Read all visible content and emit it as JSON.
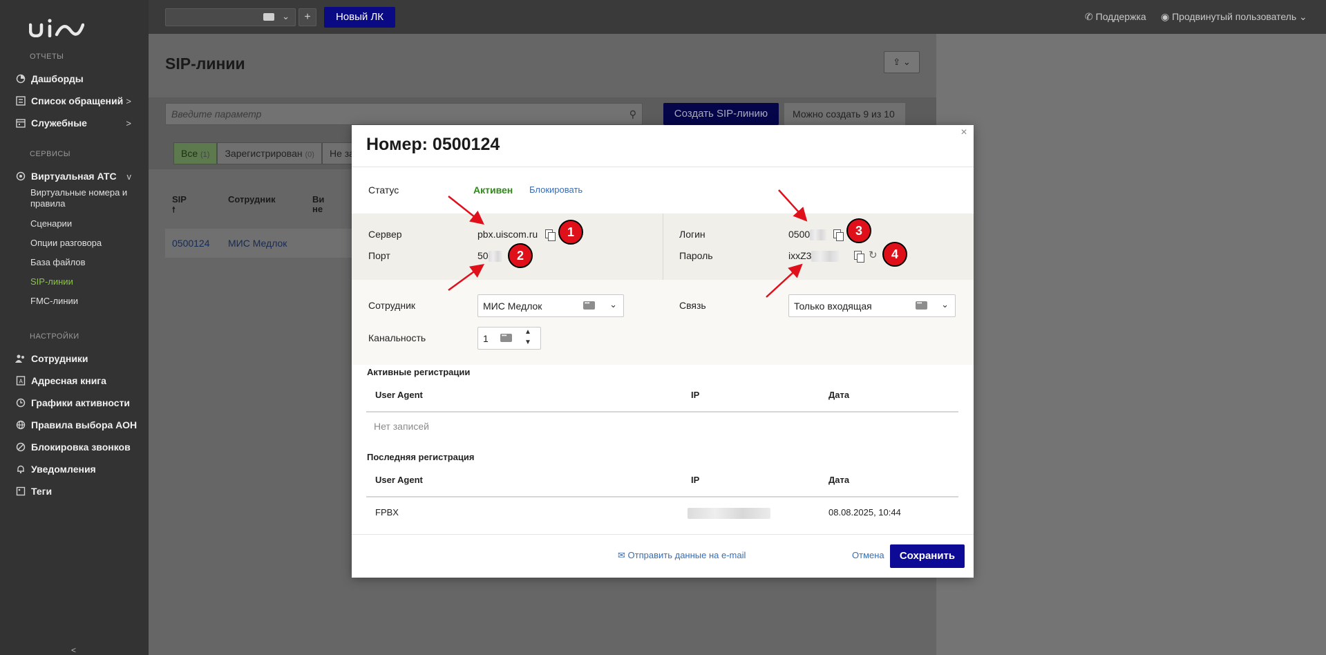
{
  "app": {
    "logo_text": "uis"
  },
  "sidebar": {
    "reports_header": "ОТЧЕТЫ",
    "services_header": "СЕРВИСЫ",
    "settings_header": "НАСТРОЙКИ",
    "reports": [
      {
        "label": "Дашборды",
        "icon": "pie-chart-icon",
        "chevron": ""
      },
      {
        "label": "Список обращений",
        "icon": "list-icon",
        "chevron": ">"
      },
      {
        "label": "Служебные",
        "icon": "calendar-icon",
        "chevron": ">"
      }
    ],
    "vats": {
      "label": "Виртуальная АТС",
      "icon": "vats-icon",
      "chevron": "v"
    },
    "vats_sub": [
      "Виртуальные номера и правила",
      "Сценарии",
      "Опции разговора",
      "База файлов",
      "SIP-линии",
      "FMC-линии"
    ],
    "settings": [
      {
        "label": "Сотрудники",
        "icon": "users-icon"
      },
      {
        "label": "Адресная книга",
        "icon": "address-book-icon"
      },
      {
        "label": "Графики активности",
        "icon": "clock-icon"
      },
      {
        "label": "Правила выбора АОН",
        "icon": "globe-icon"
      },
      {
        "label": "Блокировка звонков",
        "icon": "block-icon"
      },
      {
        "label": "Уведомления",
        "icon": "bell-icon"
      },
      {
        "label": "Теги",
        "icon": "tag-icon"
      }
    ],
    "collapse_glyph": "<"
  },
  "topbar": {
    "new_lk": "Новый ЛК",
    "plus": "+",
    "support": "Поддержка",
    "user": "Продвинутый пользователь"
  },
  "page": {
    "title": "SIP-линии",
    "search_placeholder": "Введите параметр",
    "create_button": "Создать SIP-линию",
    "limit_note": "Можно создать 9 из 10",
    "tabs": [
      {
        "label": "Все",
        "count": "(1)"
      },
      {
        "label": "Зарегистрирован",
        "count": "(0)"
      },
      {
        "label": "Не зар",
        "count": ""
      }
    ],
    "columns": [
      "SIP",
      "Сотрудник",
      "Ви",
      "не"
    ],
    "sort_arrow": "🠕",
    "row": {
      "sip": "0500124",
      "employee": "МИС Медлок"
    }
  },
  "modal": {
    "title": "Номер: 0500124",
    "close": "×",
    "status_label": "Статус",
    "status_value": "Активен",
    "block_link": "Блокировать",
    "server_label": "Сервер",
    "server_value": "pbx.uiscom.ru",
    "port_label": "Порт",
    "port_value": "50",
    "login_label": "Логин",
    "login_value": "0500",
    "password_label": "Пароль",
    "password_value": "ixxZ3",
    "employee_label": "Сотрудник",
    "employee_value": "МИС Медлок",
    "channels_label": "Канальность",
    "channels_value": "1",
    "link_label": "Связь",
    "link_value": "Только входящая",
    "active_reg_title": "Активные регистрации",
    "last_reg_title": "Последняя регистрация",
    "col_user_agent": "User Agent",
    "col_ip": "IP",
    "col_date": "Дата",
    "no_records": "Нет записей",
    "last_reg_row": {
      "user_agent": "FPBX",
      "date": "08.08.2025, 10:44"
    },
    "email_link": "Отправить данные на e-mail",
    "cancel": "Отмена",
    "save": "Сохранить"
  },
  "annotations": [
    "1",
    "2",
    "3",
    "4"
  ],
  "colors": {
    "brand_navy": "#0d0a96",
    "status_green": "#2e8a17",
    "link_blue": "#3a6db3",
    "badge_red": "#e0101b",
    "active_nav": "#8bc34a"
  }
}
